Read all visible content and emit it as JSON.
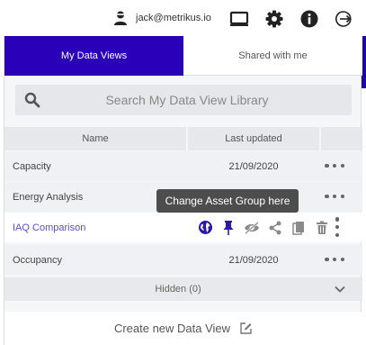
{
  "user": {
    "email": "jack@metrikus.io"
  },
  "topbar_icons": [
    "user-icon",
    "monitor-icon",
    "gear-icon",
    "info-icon",
    "logout-icon"
  ],
  "tabs": [
    {
      "label": "My Data Views",
      "active": true
    },
    {
      "label": "Shared with me",
      "active": false
    }
  ],
  "search": {
    "placeholder": "Search My Data View Library"
  },
  "table": {
    "columns": [
      "Name",
      "Last updated"
    ],
    "rows": [
      {
        "name": "Capacity",
        "last_updated": "21/09/2020"
      },
      {
        "name": "Energy Analysis",
        "last_updated": ""
      },
      {
        "name": "IAQ Comparison",
        "last_updated": "",
        "highlighted": true,
        "actions": [
          "globe-icon",
          "pin-icon",
          "hide-icon",
          "share-icon",
          "copy-icon",
          "trash-icon",
          "more-vertical-icon"
        ]
      },
      {
        "name": "Occupancy",
        "last_updated": "21/09/2020"
      }
    ]
  },
  "tooltip": "Change Asset Group here",
  "hidden": {
    "label": "Hidden (0)"
  },
  "create": {
    "label": "Create new Data View"
  },
  "colors": {
    "accent": "#2a00b8",
    "link": "#5a4fc4",
    "tooltip_bg": "#4d4d4d"
  }
}
